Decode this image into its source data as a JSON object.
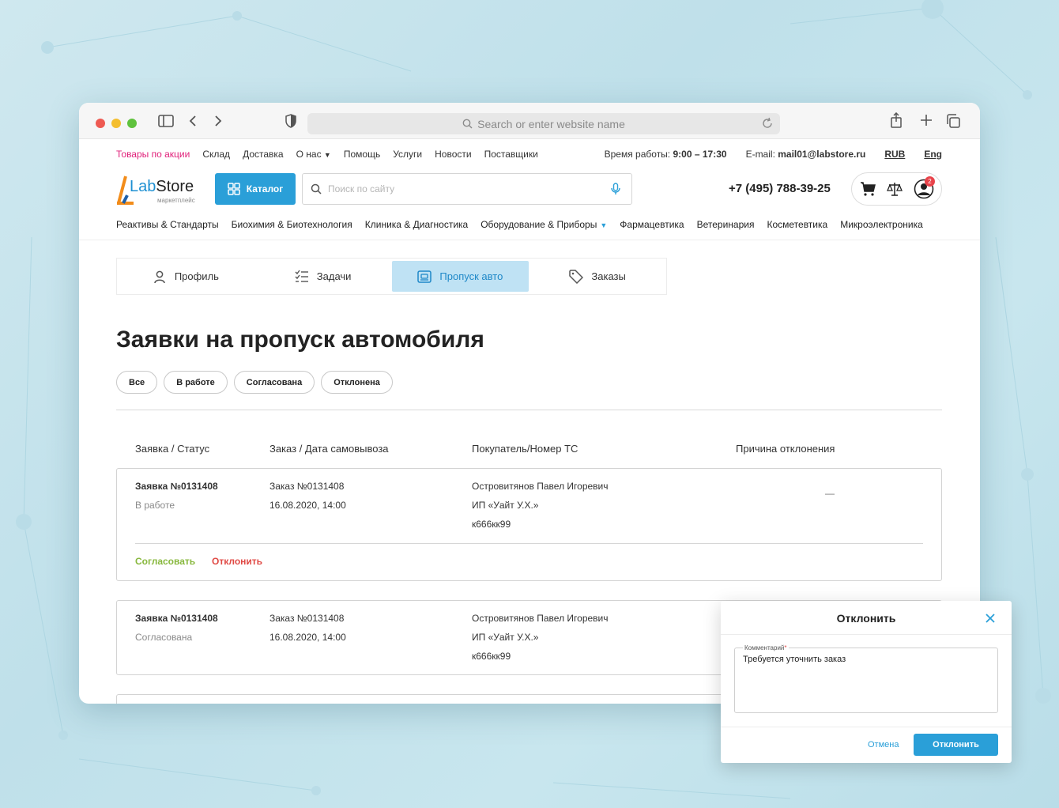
{
  "browser": {
    "address_placeholder": "Search or enter website name"
  },
  "topbar": {
    "links": [
      "Товары по акции",
      "Склад",
      "Доставка",
      "О нас",
      "Помощь",
      "Услуги",
      "Новости",
      "Поставщики"
    ],
    "hours_label": "Время работы:",
    "hours_value": "9:00 – 17:30",
    "email_label": "E-mail:",
    "email_value": "mail01@labstore.ru",
    "currency": "RUB",
    "language": "Eng"
  },
  "header": {
    "logo_main": "LabStore",
    "logo_sub": "маркетплейс",
    "catalog_label": "Каталог",
    "search_placeholder": "Поиск по сайту",
    "phone": "+7 (495) 788-39-25",
    "notification_count": "2"
  },
  "categories": [
    "Реактивы & Стандарты",
    "Биохимия & Биотехнология",
    "Клиника & Диагностика",
    "Оборудование & Приборы",
    "Фармацевтика",
    "Ветеринария",
    "Косметевтика",
    "Микроэлектроника"
  ],
  "tabs": [
    {
      "label": "Профиль",
      "icon": "user-icon"
    },
    {
      "label": "Задачи",
      "icon": "checklist-icon"
    },
    {
      "label": "Пропуск авто",
      "icon": "car-pass-icon"
    },
    {
      "label": "Заказы",
      "icon": "tag-icon"
    }
  ],
  "active_tab": "Пропуск авто",
  "page_title": "Заявки на пропуск автомобиля",
  "filters": [
    "Все",
    "В работе",
    "Согласована",
    "Отклонена"
  ],
  "table": {
    "headers": [
      "Заявка / Статус",
      "Заказ / Дата самовывоза",
      "Покупатель/Номер ТС",
      "Причина отклонения"
    ],
    "rows": [
      {
        "request": "Заявка №0131408",
        "status": "В работе",
        "order": "Заказ №0131408",
        "date": "16.08.2020, 14:00",
        "buyer": "Островитянов Павел Игоревич",
        "company": "ИП «Уайт У.Х.»",
        "plate": "к666кк99",
        "reason": "—",
        "approve_label": "Согласовать",
        "reject_label": "Отклонить"
      },
      {
        "request": "Заявка №0131408",
        "status": "Согласована",
        "order": "Заказ №0131408",
        "date": "16.08.2020, 14:00",
        "buyer": "Островитянов Павел Игоревич",
        "company": "ИП «Уайт У.Х.»",
        "plate": "к666кк99"
      }
    ]
  },
  "modal": {
    "title": "Отклонить",
    "field_label": "Комментарий",
    "field_required": "*",
    "field_value": "Требуется уточнить заказ",
    "cancel_label": "Отмена",
    "confirm_label": "Отклонить"
  },
  "colors": {
    "accent": "#2a9fd8",
    "promo": "#e0217a",
    "approve": "#88b83e",
    "reject": "#e04a45",
    "active_tab_bg": "#bfe2f4"
  }
}
